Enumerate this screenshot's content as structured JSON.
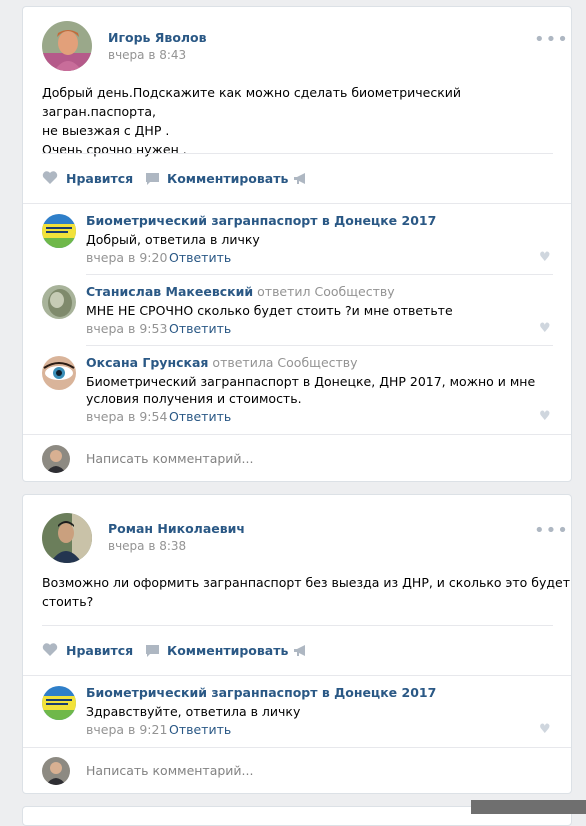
{
  "posts": [
    {
      "author": "Игорь Яволов",
      "time": "вчера в 8:43",
      "more_icon": "more-dots-icon",
      "text_lines": [
        "Добрый день.Подскажите как можно сделать биометрический загран.паспорта,",
        "не выезжая с ДНР .",
        "Очень срочно нужен ."
      ],
      "actions": {
        "like": "Нравится",
        "comment": "Комментировать"
      },
      "comments": [
        {
          "author": "Биометрический загранпаспорт в Донецке 2017",
          "meta": "",
          "text_lines": [
            "Добрый, ответила в личку"
          ],
          "time": "вчера в 9:20",
          "reply": "Ответить"
        },
        {
          "author": "Станислав Макеевский",
          "meta": "ответил Сообществу",
          "text_lines": [
            "МНЕ НЕ СРОЧНО сколько будет стоить ?и мне ответьте"
          ],
          "time": "вчера в 9:53",
          "reply": "Ответить"
        },
        {
          "author": "Оксана Грунская",
          "meta": "ответила Сообществу",
          "text_lines": [
            "Биометрический загранпаспорт в Донецке, ДНР 2017, можно и мне",
            "условия получения и стоимость."
          ],
          "time": "вчера в 9:54",
          "reply": "Ответить"
        }
      ],
      "input_placeholder": "Написать комментарий..."
    },
    {
      "author": "Роман Николаевич",
      "time": "вчера в 8:38",
      "more_icon": "more-dots-icon",
      "text_lines": [
        "Возможно ли оформить загранпаспорт без выезда из ДНР, и сколько это будет",
        "стоить?"
      ],
      "actions": {
        "like": "Нравится",
        "comment": "Комментировать"
      },
      "comments": [
        {
          "author": "Биометрический загранпаспорт в Донецке 2017",
          "meta": "",
          "text_lines": [
            "Здравствуйте, ответила в личку"
          ],
          "time": "вчера в 9:21",
          "reply": "Ответить"
        }
      ],
      "input_placeholder": "Написать комментарий..."
    }
  ],
  "colors": {
    "background": "#edeef0",
    "link": "#2a5885",
    "muted": "#939393",
    "icon": "#aeb7c2"
  }
}
